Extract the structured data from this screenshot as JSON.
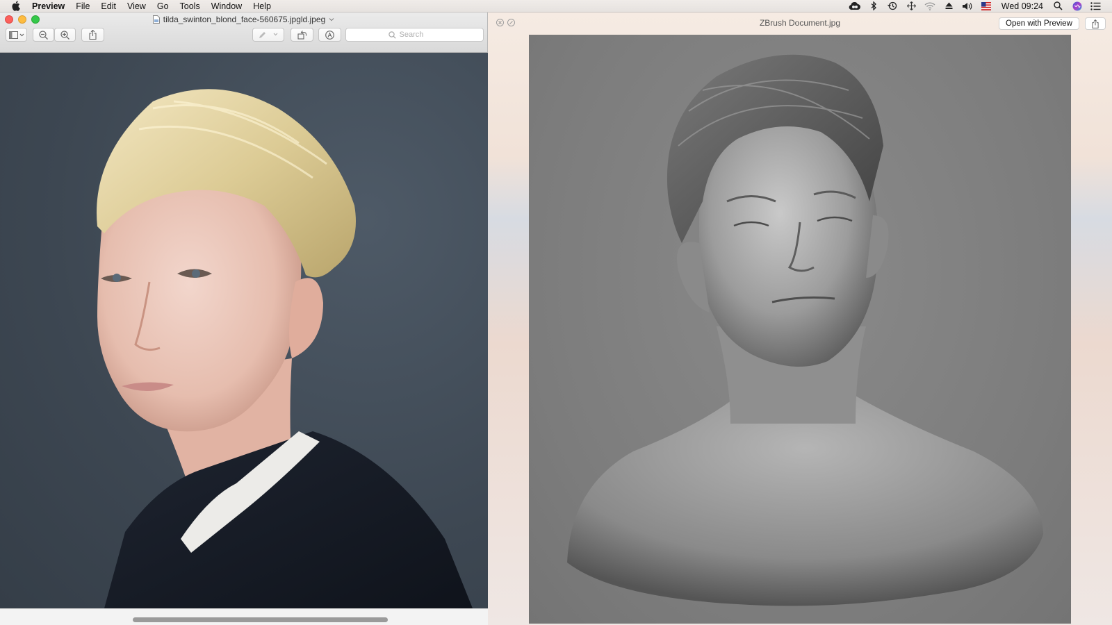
{
  "menubar": {
    "app_name": "Preview",
    "items": [
      "File",
      "Edit",
      "View",
      "Go",
      "Tools",
      "Window",
      "Help"
    ],
    "clock": "Wed 09:24",
    "status_icons": [
      "creative-cloud-icon",
      "bluetooth-icon",
      "time-machine-icon",
      "move-icon",
      "wifi-icon",
      "eject-icon",
      "volume-icon",
      "us-flag-icon",
      "spotlight-icon",
      "siri-icon",
      "notification-center-icon"
    ]
  },
  "preview": {
    "title": "tilda_swinton_blond_face-560675.jpgld.jpeg",
    "search_placeholder": "Search",
    "colors": {
      "close": "#fc605c",
      "minimize": "#fdbc40",
      "zoom": "#34c84a"
    }
  },
  "quicklook": {
    "title": "ZBrush Document.jpg",
    "open_button": "Open with Preview"
  }
}
